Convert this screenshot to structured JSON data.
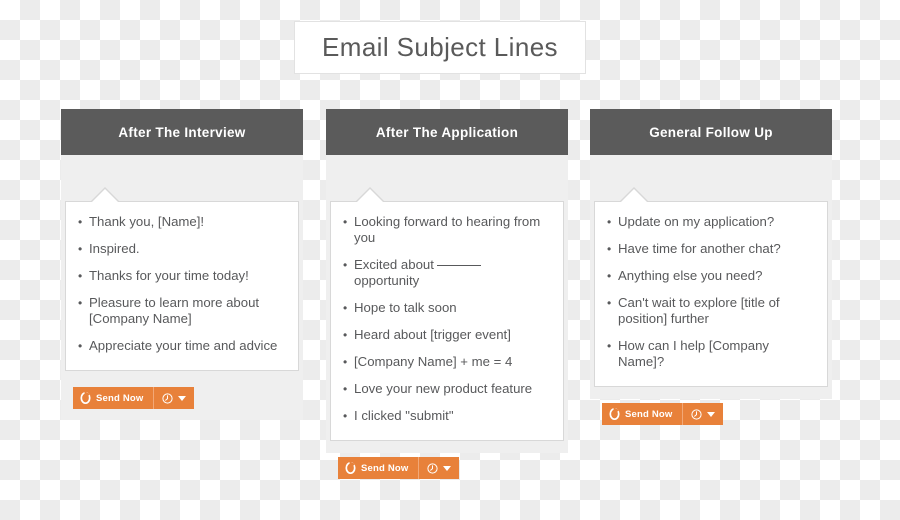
{
  "title": {
    "text": "Email Subject Lines"
  },
  "columns": [
    {
      "header": "After The Interview",
      "items": [
        {
          "text": "Thank you, [Name]!"
        },
        {
          "text": "Inspired."
        },
        {
          "text": "Thanks for your time today!"
        },
        {
          "text": "Pleasure to learn more about [Company Name]"
        },
        {
          "text": "Appreciate your time and advice"
        }
      ],
      "button": {
        "label": "Send Now",
        "send_icon": "sprocket-icon",
        "schedule_icon": "clock-icon",
        "dropdown_icon": "caret-down-icon"
      }
    },
    {
      "header": "After The Application",
      "items": [
        {
          "text": "Looking forward to hearing from you"
        },
        {
          "before": "Excited about",
          "blank": true,
          "after": "opportunity"
        },
        {
          "text": "Hope to talk soon"
        },
        {
          "text": "Heard about [trigger event]"
        },
        {
          "text": "[Company Name] + me = 4"
        },
        {
          "text": "Love your new product feature"
        },
        {
          "text": "I clicked \"submit\""
        }
      ],
      "button": {
        "label": "Send Now",
        "send_icon": "sprocket-icon",
        "schedule_icon": "clock-icon",
        "dropdown_icon": "caret-down-icon"
      }
    },
    {
      "header": "General Follow Up",
      "items": [
        {
          "text": "Update on my application?"
        },
        {
          "text": "Have time for another chat?"
        },
        {
          "text": "Anything else you need?"
        },
        {
          "text": "Can't wait to explore [title of position] further"
        },
        {
          "text": "How can I help [Company Name]?"
        }
      ],
      "button": {
        "label": "Send Now",
        "send_icon": "sprocket-icon",
        "schedule_icon": "clock-icon",
        "dropdown_icon": "caret-down-icon"
      }
    }
  ],
  "colors": {
    "header_bar": "#5b5b5b",
    "panel": "#efefef",
    "accent_orange": "#e8813a",
    "text": "#58595b"
  }
}
